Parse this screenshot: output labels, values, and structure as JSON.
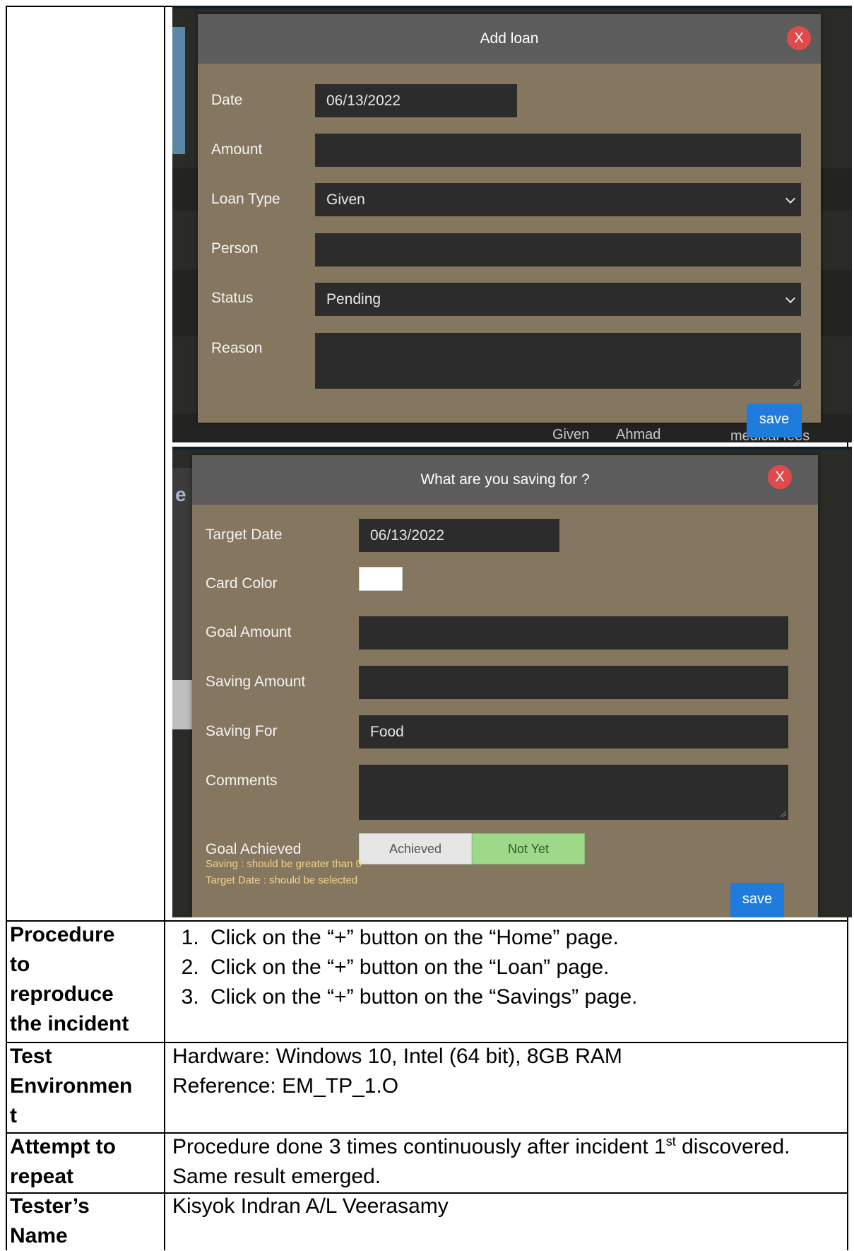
{
  "loan_modal": {
    "title": "Add loan",
    "close": "X",
    "labels": {
      "date": "Date",
      "amount": "Amount",
      "loan_type": "Loan Type",
      "person": "Person",
      "status": "Status",
      "reason": "Reason"
    },
    "values": {
      "date": "06/13/2022",
      "amount": "",
      "loan_type": "Given",
      "person": "",
      "status": "Pending",
      "reason": ""
    },
    "save": "save",
    "background_row": {
      "type": "Given",
      "person": "Ahmad",
      "reason": "medical fees",
      "frag1": "es",
      "frag2": "es"
    }
  },
  "saving_modal": {
    "title": "What are you saving for ?",
    "close": "X",
    "labels": {
      "target_date": "Target Date",
      "card_color": "Card Color",
      "goal_amount": "Goal Amount",
      "saving_amount": "Saving Amount",
      "saving_for": "Saving For",
      "comments": "Comments",
      "goal_achieved": "Goal Achieved"
    },
    "values": {
      "target_date": "06/13/2022",
      "card_color": "#ffffff",
      "goal_amount": "",
      "saving_amount": "",
      "saving_for": "Food",
      "comments": ""
    },
    "toggle": {
      "achieved": "Achieved",
      "not_yet": "Not Yet",
      "selected": "Not Yet"
    },
    "errors": [
      "Saving : should be greater than 0",
      "Target Date : should be selected"
    ],
    "save": "save",
    "background_frag": "e"
  },
  "rows": {
    "procedure": {
      "label": "Procedure\nto\nreproduce\nthe incident",
      "steps": [
        "Click on the “+” button on the “Home” page.",
        "Click on the “+” button on the “Loan” page.",
        "Click on the “+” button on the “Savings” page."
      ]
    },
    "environment": {
      "label": "Test\nEnvironmen\nt",
      "hardware": "Hardware: Windows 10, Intel (64 bit), 8GB RAM",
      "reference": "Reference: EM_TP_1.O"
    },
    "attempt": {
      "label": "Attempt to\nrepeat",
      "line1_pre": "Procedure done 3 times continuously after incident 1",
      "line1_sup": "st",
      "line1_post": " discovered.",
      "line2": "Same result emerged."
    },
    "tester": {
      "label": "Tester’s\nName",
      "name": "Kisyok Indran A/L Veerasamy"
    }
  },
  "colors": {
    "modal_body": "#85775f",
    "modal_header": "#5c5c5c",
    "field_bg": "#2c2c2c",
    "close_red": "#e14a4a",
    "save_blue": "#1f7bdc",
    "not_yet_green": "#9ed98a",
    "error_text": "#f3d28e"
  }
}
